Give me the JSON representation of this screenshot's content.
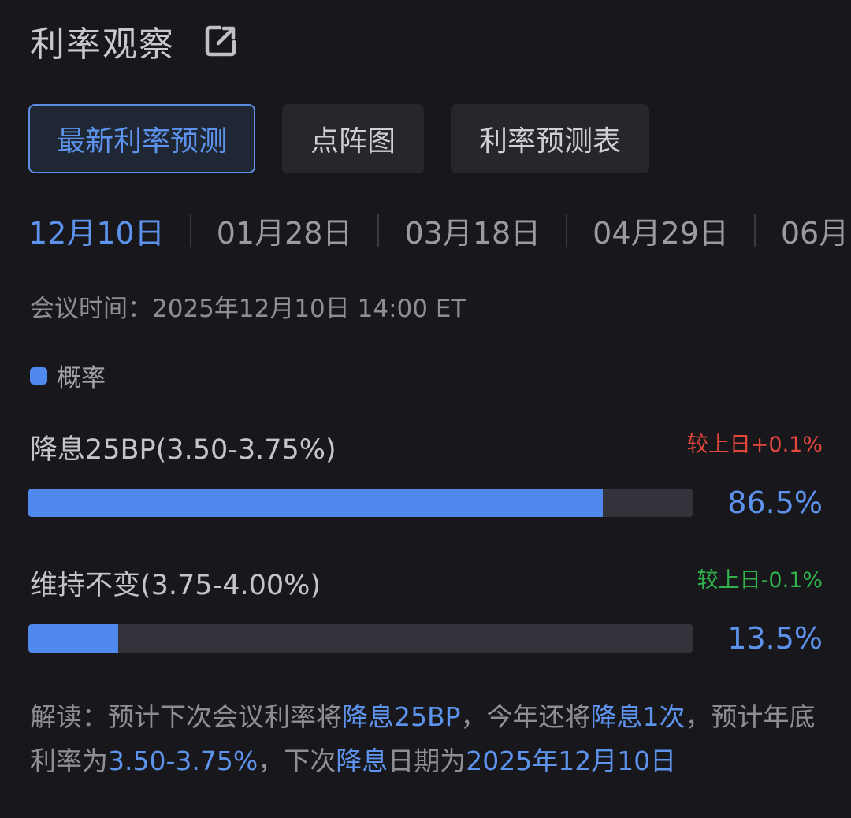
{
  "header": {
    "title": "利率观察",
    "icon": "external-link-icon"
  },
  "tabs": [
    {
      "label": "最新利率预测",
      "active": true
    },
    {
      "label": "点阵图",
      "active": false
    },
    {
      "label": "利率预测表",
      "active": false
    }
  ],
  "dates": [
    {
      "label": "12月10日",
      "active": true
    },
    {
      "label": "01月28日",
      "active": false
    },
    {
      "label": "03月18日",
      "active": false
    },
    {
      "label": "04月29日",
      "active": false
    },
    {
      "label": "06月",
      "active": false
    }
  ],
  "meeting": {
    "label": "会议时间：",
    "value": "2025年12月10日 14:00 ET"
  },
  "legend": {
    "label": "概率",
    "color": "#5089ee"
  },
  "outcomes": [
    {
      "label": "降息25BP(3.50-3.75%)",
      "change": "较上日+0.1%",
      "change_color": "#e5473d",
      "percent_text": "86.5%",
      "probability": 0.865
    },
    {
      "label": "维持不变(3.75-4.00%)",
      "change": "较上日-0.1%",
      "change_color": "#2fb34a",
      "percent_text": "13.5%",
      "probability": 0.135
    }
  ],
  "interpretation": {
    "prefix": "解读：",
    "seg1": "预计下次会议利率将",
    "hl1": "降息25BP",
    "seg2": "，今年还将",
    "hl2": "降息1次",
    "seg3": "，预计年底利率为",
    "hl3": "3.50-3.75%",
    "seg4": "，下次",
    "hl4": "降息",
    "seg5": "日期为",
    "hl5": "2025年12月10日"
  },
  "colors": {
    "accent": "#5d93ec",
    "bar_fill": "#5089ee",
    "up": "#e5473d",
    "down": "#2fb34a",
    "background": "#18181c"
  }
}
